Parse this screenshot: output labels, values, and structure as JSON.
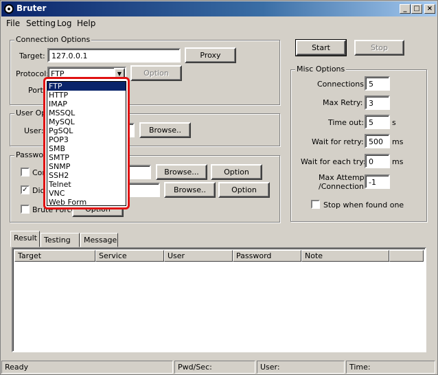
{
  "window": {
    "title": "Bruter"
  },
  "menu": [
    "File",
    "Setting",
    "Log",
    "Help"
  ],
  "connection": {
    "legend": "Connection Options",
    "target_label": "Target:",
    "target_value": "127.0.0.1",
    "proxy_label": "Proxy",
    "protocol_label": "Protocol:",
    "protocol_value": "FTP",
    "option_label": "Option",
    "port_label": "Port"
  },
  "protocols": [
    "FTP",
    "HTTP",
    "IMAP",
    "MSSQL",
    "MySQL",
    "PgSQL",
    "POP3",
    "SMB",
    "SMTP",
    "SNMP",
    "SSH2",
    "Telnet",
    "VNC",
    "Web Form"
  ],
  "user": {
    "legend": "User Opti",
    "user_label": "User:",
    "browse_label": "Browse.."
  },
  "password": {
    "legend": "Passwor",
    "combo_label": "Com",
    "combo_browse": "Browse...",
    "combo_option": "Option",
    "dict_label": "Dicti",
    "dict_browse": "Browse..",
    "dict_option": "Option",
    "brute_label": "Brute Force",
    "brute_option": "Option"
  },
  "actions": {
    "start": "Start",
    "stop": "Stop"
  },
  "misc": {
    "legend": "Misc Options",
    "connections_label": "Connections:",
    "connections_value": "5",
    "max_retry_label": "Max Retry:",
    "max_retry_value": "3",
    "timeout_label": "Time out:",
    "timeout_value": "5",
    "timeout_unit": "s",
    "wait_retry_label": "Wait for retry:",
    "wait_retry_value": "500",
    "wait_retry_unit": "ms",
    "wait_try_label": "Wait for each try:",
    "wait_try_value": "0",
    "wait_try_unit": "ms",
    "max_attempt_label_1": "Max Attempt",
    "max_attempt_label_2": "/Connection:",
    "max_attempt_value": "-1",
    "stop_found_label": "Stop when found one"
  },
  "tabs": [
    "Result",
    "Testing",
    "Message"
  ],
  "columns": [
    "Target",
    "Service",
    "User",
    "Password",
    "Note"
  ],
  "status": {
    "ready": "Ready",
    "pwd_sec": "Pwd/Sec:",
    "user": "User:",
    "time": "Time:"
  }
}
